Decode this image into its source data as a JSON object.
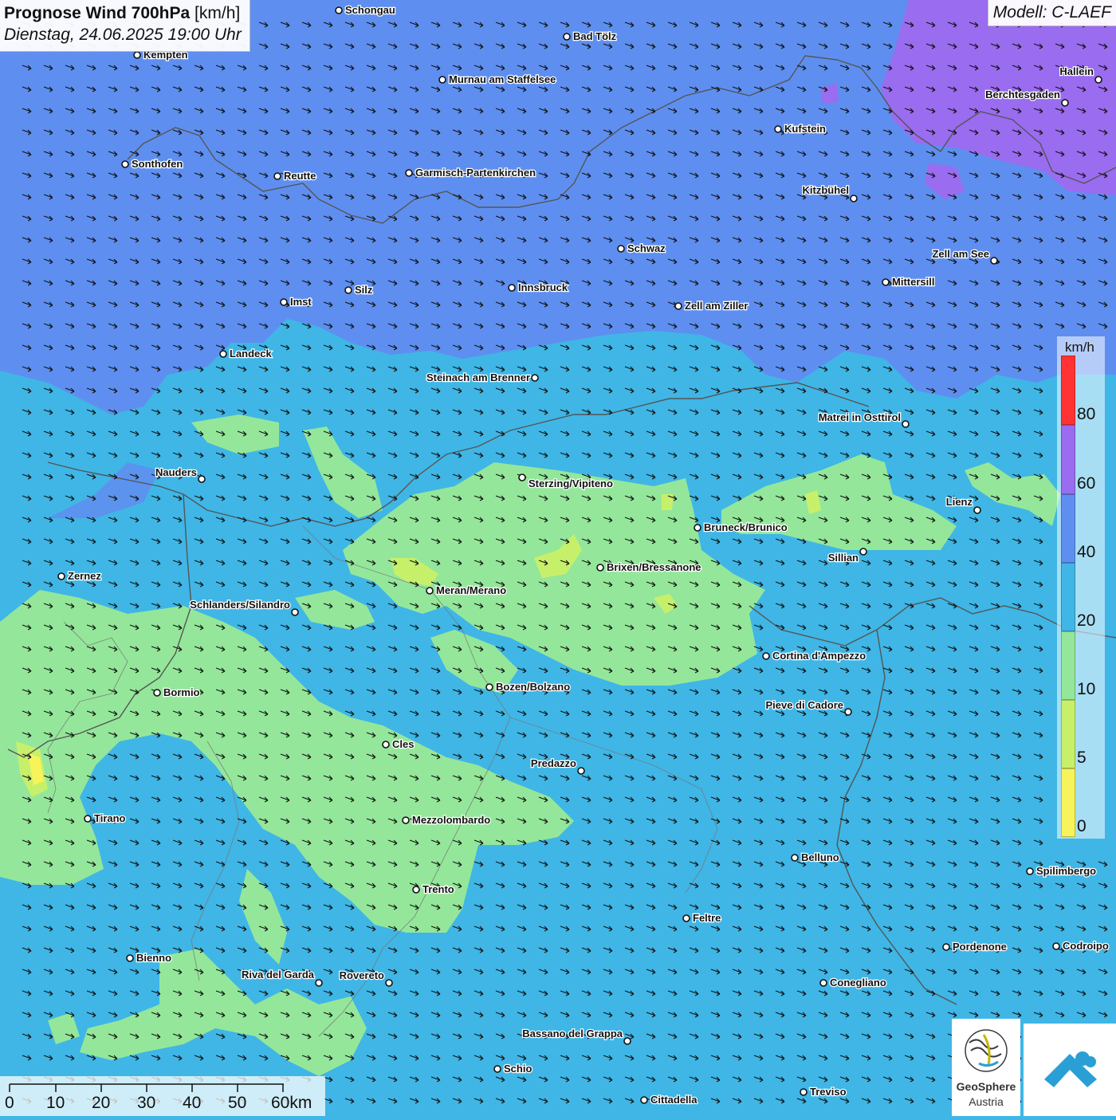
{
  "header": {
    "title_bold": "Prognose Wind 700hPa",
    "title_unit": "[km/h]",
    "datetime": "Dienstag, 24.06.2025 19:00 Uhr",
    "model": "Modell: C-LAEF"
  },
  "colors": {
    "speed_0_5": "#f6f45a",
    "speed_5_10": "#c7f06a",
    "speed_10_20": "#94e79a",
    "speed_20_40": "#3fb6e6",
    "speed_40_60": "#5e8ff0",
    "speed_60_80": "#9a6cf0",
    "speed_80_plus": "#ff3333",
    "arrow": "#111111",
    "border": "#555555"
  },
  "legend": {
    "unit": "km/h",
    "labels": [
      "80",
      "60",
      "40",
      "20",
      "10",
      "5",
      "0"
    ]
  },
  "wind_arrows": {
    "direction": "toward south-east"
  },
  "cities": [
    {
      "name": "Schongau"
    },
    {
      "name": "Bad Tölz"
    },
    {
      "name": "Kempten"
    },
    {
      "name": "Murnau am Staffelsee"
    },
    {
      "name": "Hallein"
    },
    {
      "name": "Berchtesgaden"
    },
    {
      "name": "Kufstein"
    },
    {
      "name": "Sonthofen"
    },
    {
      "name": "Reutte"
    },
    {
      "name": "Garmisch-Partenkirchen"
    },
    {
      "name": "Kitzbühel"
    },
    {
      "name": "Schwaz"
    },
    {
      "name": "Zell am See"
    },
    {
      "name": "Mittersill"
    },
    {
      "name": "Silz"
    },
    {
      "name": "Innsbruck"
    },
    {
      "name": "Imst"
    },
    {
      "name": "Zell am Ziller"
    },
    {
      "name": "Landeck"
    },
    {
      "name": "Steinach am Brenner"
    },
    {
      "name": "Matrei in Osttirol"
    },
    {
      "name": "Nauders"
    },
    {
      "name": "Sterzing/Vipiteno"
    },
    {
      "name": "Lienz"
    },
    {
      "name": "Bruneck/Brunico"
    },
    {
      "name": "Sillian"
    },
    {
      "name": "Brixen/Bressanone"
    },
    {
      "name": "Zernez"
    },
    {
      "name": "Meran/Merano"
    },
    {
      "name": "Schlanders/Silandro"
    },
    {
      "name": "Cortina d'Ampezzo"
    },
    {
      "name": "Bozen/Bolzano"
    },
    {
      "name": "Bormio"
    },
    {
      "name": "Pieve di Cadore"
    },
    {
      "name": "Cles"
    },
    {
      "name": "Predazzo"
    },
    {
      "name": "Tirano"
    },
    {
      "name": "Mezzolombardo"
    },
    {
      "name": "Belluno"
    },
    {
      "name": "Spilimbergo"
    },
    {
      "name": "Trento"
    },
    {
      "name": "Feltre"
    },
    {
      "name": "Bienno"
    },
    {
      "name": "Pordenone"
    },
    {
      "name": "Codroipo"
    },
    {
      "name": "Riva del Garda"
    },
    {
      "name": "Rovereto"
    },
    {
      "name": "Conegliano"
    },
    {
      "name": "Bassano del Grappa"
    },
    {
      "name": "Schio"
    },
    {
      "name": "Treviso"
    },
    {
      "name": "Cittadella"
    }
  ],
  "scale": {
    "labels": [
      "0",
      "10",
      "20",
      "30",
      "40",
      "50",
      "60km"
    ]
  },
  "logo": {
    "line1": "GeoSphere",
    "line2": "Austria"
  }
}
